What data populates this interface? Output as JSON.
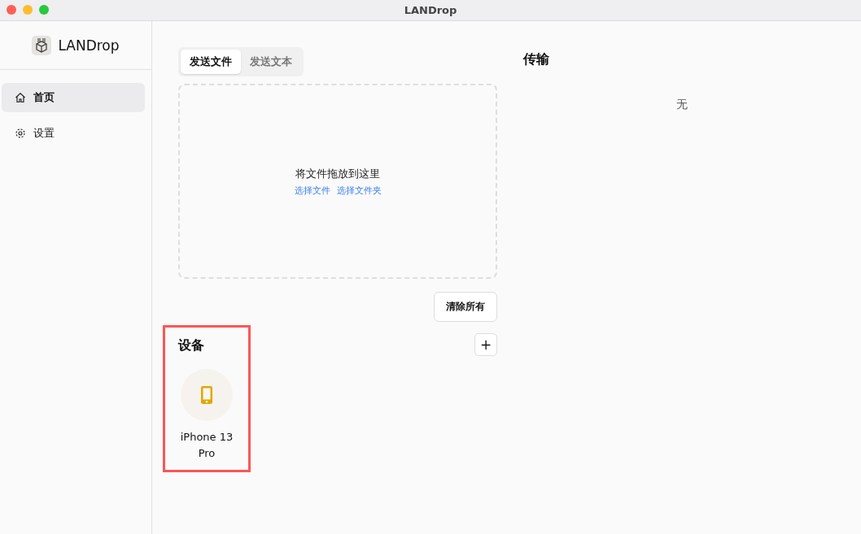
{
  "window": {
    "title": "LANDrop"
  },
  "sidebar": {
    "app_name": "LANDrop",
    "items": [
      {
        "label": "首页",
        "kind": "home",
        "selected": true
      },
      {
        "label": "设置",
        "kind": "settings",
        "selected": false
      }
    ]
  },
  "send_tabs": [
    {
      "label": "发送文件",
      "selected": true
    },
    {
      "label": "发送文本",
      "selected": false
    }
  ],
  "drop_zone": {
    "prompt": "将文件拖放到这里",
    "links": [
      "选择文件",
      "选择文件夹"
    ]
  },
  "clear_button": "清除所有",
  "devices": {
    "title": "设备",
    "highlighted": true,
    "add_button": "+",
    "items": [
      {
        "name": "iPhone 13 Pro",
        "kind": "phone"
      }
    ]
  },
  "transfers": {
    "title": "传输",
    "empty_text": "无"
  }
}
